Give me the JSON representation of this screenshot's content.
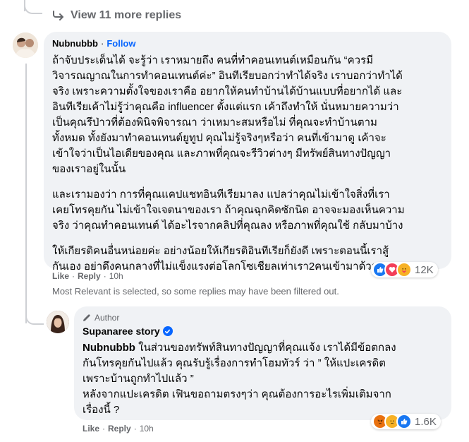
{
  "view_more": {
    "label": "View 11 more replies"
  },
  "comment": {
    "author": "Nubnubbb",
    "follow_label": "Follow",
    "separator": "·",
    "paragraphs": [
      [
        "ถ้าจับประเด็นได้ จะรู้ว่า เราหมายถึง คนที่ทำคอนเทนต์เหมือนกัน “ควรมี",
        "วิจารณญาณในการทำคอนเทนต์ค่ะ” อินทีเรียบอกว่าทำได้จริง เราบอกว่าทำได้",
        "จริง เพราะความตั้งใจของเราคือ อยากให้คนทำบ้านได้บ้านแบบที่อยากได้ และ",
        "อินทีเรียเค้าไม่รู้ว่าคุณคือ influencer ตั้งแต่แรก เค้าถึงทำให้ นั่นหมายความว่า",
        "เป็นคุณรึป่าวที่ต้องพินิจพิจารณา ว่าเหมาะสมหรือไม่ ที่คุณจะทำบ้านตาม",
        "ทั้งหมด ทั้งยังมาทำคอนเทนต์ยูทูป คุณไม่รู้จริงๆหรือว่า คนที่เข้ามาดู เค้าจะ",
        "เข้าใจว่าเป็นไอเดียของคุณ และภาพที่คุณจะรีวิวต่างๆ มีทรัพย์สินทางปัญญา",
        "ของเราอยู่ในนั้น"
      ],
      [
        "และเรามองว่า การที่คุณแคปแชทอินทีเรียมาลง แปลว่าคุณไม่เข้าใจสิ่งที่เรา",
        "เคยโทรคุยกัน ไม่เข้าใจเจตนาของเรา ถ้าคุณฉุกคิดซักนิด อาจจะมองเห็นความ",
        "จริง ว่าคุณทำคอนเทนต์ ได้อะไรจากคลิปที่คุณลง หรือภาพที่คุณใช้ กลับมาบ้าง"
      ],
      [
        "ให้เกียรติคนอื่นหน่อยค่ะ อย่างน้อยให้เกียรติอินทีเรียก็ยังดี เพราะตอนนี้เราสู้",
        "กันเอง อย่าดึงคนกลางที่ไม่แข็งแรงต่อโลกโซเชียลเท่าเรา2คนเข้ามาด้วย"
      ]
    ],
    "like_label": "Like",
    "reply_label": "Reply",
    "time": "10h",
    "reaction_count": "12K",
    "reactions": [
      "like-reaction-icon",
      "love-reaction-icon",
      "care-reaction-icon"
    ]
  },
  "filter_note": "Most Relevant is selected, so some replies may have been filtered out.",
  "reply": {
    "author_tag": "Author",
    "author": "Supanaree story",
    "mention": "Nubnubbb",
    "lines": [
      " ในส่วนของทรัพท์สินทางปัญญาที่คุณแจ้ง เราได้มีข้อตกลง",
      "กันโทรคุยกันไปแล้ว คุณรับรู้เรื่องการทำโฮมทัวร์ ว่า ” ให้แปะเครดิต",
      "เพราะบ้านถูกทำไปแล้ว ”",
      "หลังจากแปะเครดิต เฟินขอถามตรงๆว่า คุณต้องการอะไรเพิ่มเติมจาก",
      "เรื่องนี้ ?"
    ],
    "like_label": "Like",
    "reply_label": "Reply",
    "time": "10h",
    "reaction_count": "1.6K",
    "reactions": [
      "angry-reaction-icon",
      "sad-reaction-icon",
      "like-reaction-icon"
    ]
  },
  "colors": {
    "link": "#0866ff",
    "bubble": "#f0f2f5",
    "muted": "#65676b"
  }
}
